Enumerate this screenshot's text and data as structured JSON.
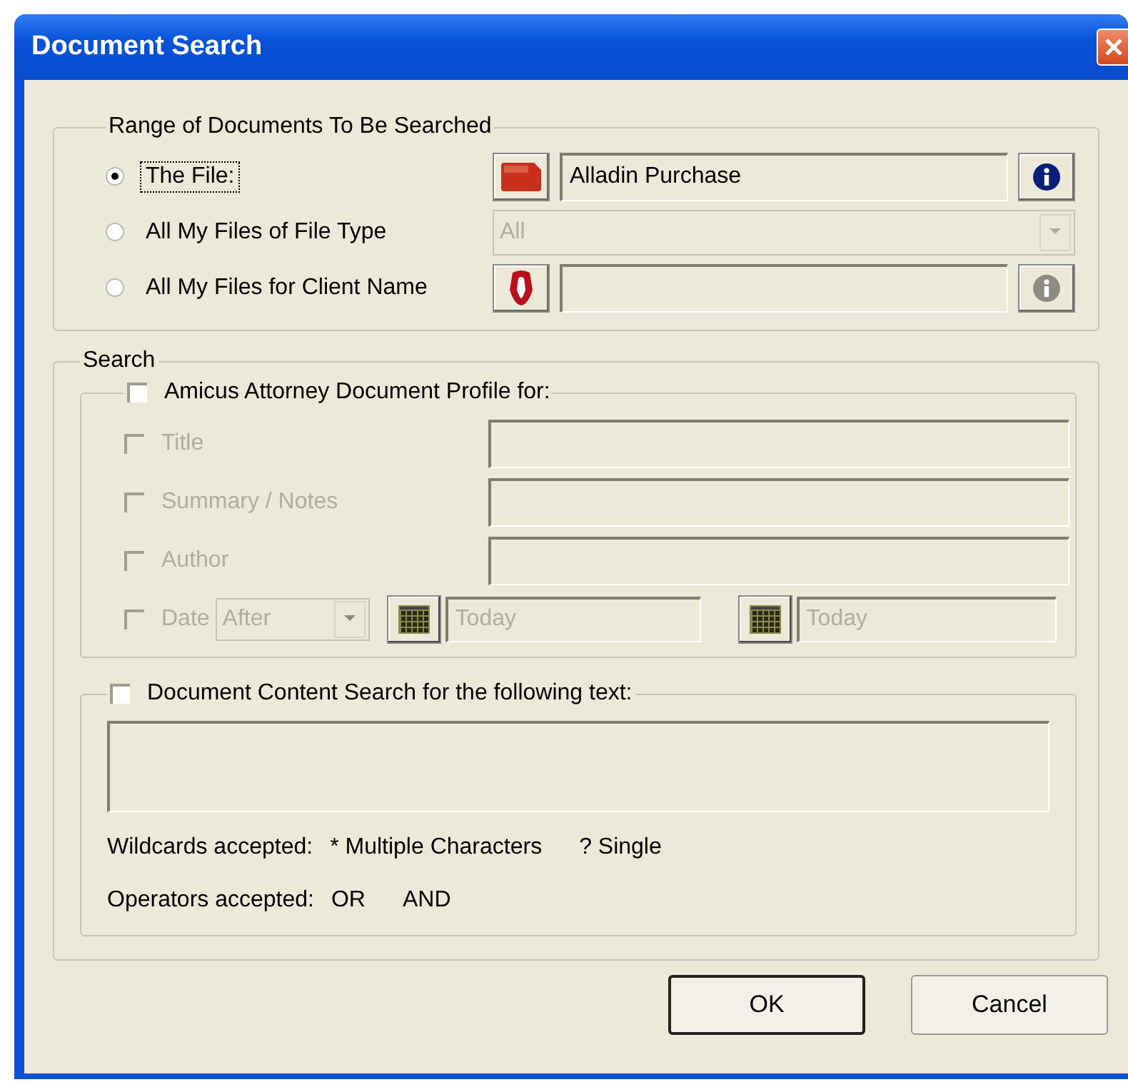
{
  "window": {
    "title": "Document Search"
  },
  "range_group": {
    "label": "Range of Documents To Be Searched",
    "options": [
      {
        "kind": "file",
        "label": "The File:",
        "selected": true,
        "value": "Alladin Purchase",
        "info_enabled": true
      },
      {
        "kind": "dropdown",
        "label": "All My Files of File Type",
        "selected": false,
        "value": "All",
        "disabled": true
      },
      {
        "kind": "client",
        "label": "All My Files for Client Name",
        "selected": false,
        "info_enabled": false
      }
    ]
  },
  "search_group": {
    "label": "Search",
    "profile": {
      "label": "Amicus Attorney Document Profile for:",
      "checked": false,
      "fields": [
        {
          "kind": "text",
          "label": "Title",
          "checked": false,
          "disabled": true
        },
        {
          "kind": "text",
          "label": "Summary / Notes",
          "checked": false,
          "disabled": true
        },
        {
          "kind": "text",
          "label": "Author",
          "checked": false,
          "disabled": true
        },
        {
          "kind": "date",
          "label": "Date",
          "checked": false,
          "disabled": true,
          "operator": "After",
          "from": "Today",
          "to": "Today"
        }
      ]
    },
    "content": {
      "label": "Document Content Search for the following text:",
      "checked": false,
      "notes": [
        [
          "Wildcards accepted:",
          "* Multiple Characters",
          "? Single"
        ],
        [
          "Operators accepted:",
          "OR",
          "AND"
        ]
      ]
    }
  },
  "buttons": [
    {
      "label": "OK",
      "default": true
    },
    {
      "label": "Cancel",
      "default": false
    }
  ]
}
